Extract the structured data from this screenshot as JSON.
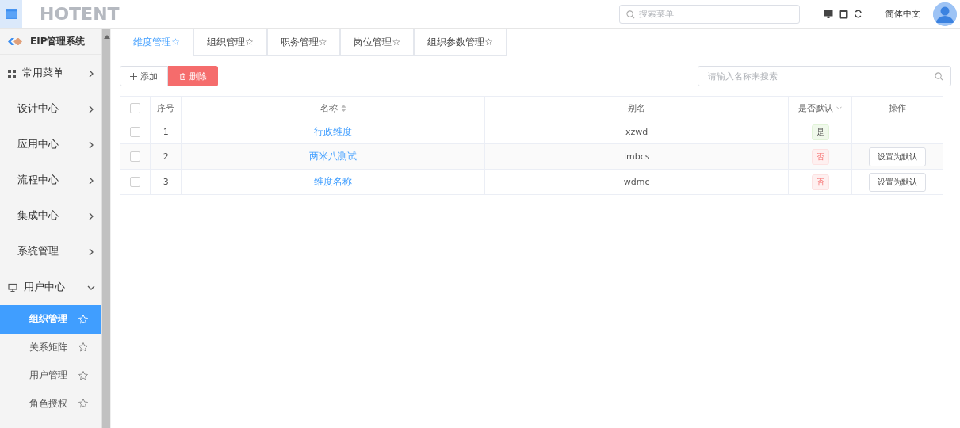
{
  "topbar": {
    "logo": "HOTENT",
    "search": {
      "placeholder": "搜索菜单"
    },
    "language": "简体中文"
  },
  "sidebar": {
    "title": "EIP管理系统",
    "items": [
      {
        "label": "常用菜单",
        "kind": "grid",
        "expanded": false
      },
      {
        "label": "设计中心",
        "kind": "plain",
        "expanded": false
      },
      {
        "label": "应用中心",
        "kind": "plain",
        "expanded": false
      },
      {
        "label": "流程中心",
        "kind": "plain",
        "expanded": false
      },
      {
        "label": "集成中心",
        "kind": "plain",
        "expanded": false
      },
      {
        "label": "系统管理",
        "kind": "plain",
        "expanded": false
      },
      {
        "label": "用户中心",
        "kind": "monitor",
        "expanded": true,
        "children": [
          {
            "label": "组织管理",
            "selected": true
          },
          {
            "label": "关系矩阵",
            "selected": false
          },
          {
            "label": "用户管理",
            "selected": false
          },
          {
            "label": "角色授权",
            "selected": false
          }
        ]
      }
    ]
  },
  "tabs": [
    {
      "label": "维度管理☆",
      "selected": true
    },
    {
      "label": "组织管理☆",
      "selected": false
    },
    {
      "label": "职务管理☆",
      "selected": false
    },
    {
      "label": "岗位管理☆",
      "selected": false
    },
    {
      "label": "组织参数管理☆",
      "selected": false
    }
  ],
  "toolbar": {
    "add": "添加",
    "delete": "删除",
    "search": {
      "placeholder": "请输入名称来搜索"
    }
  },
  "table": {
    "select_all": {
      "checked": false
    },
    "columns": [
      "序号",
      "名称",
      "别名",
      "是否默认",
      "操作"
    ],
    "rows": [
      {
        "checked": false,
        "index": "1",
        "name": "行政维度",
        "alias": "xzwd",
        "default": true,
        "default_label": "是"
      },
      {
        "checked": false,
        "index": "2",
        "name": "两米八测试",
        "alias": "lmbcs",
        "default": false,
        "default_label": "否",
        "action": "设置为默认"
      },
      {
        "checked": false,
        "index": "3",
        "name": "维度名称",
        "alias": "wdmc",
        "default": false,
        "default_label": "否",
        "action": "设置为默认"
      }
    ]
  }
}
